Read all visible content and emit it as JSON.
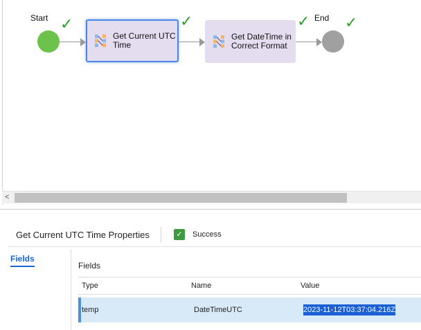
{
  "canvas": {
    "start_label": "Start",
    "end_label": "End",
    "check_mark": "✓",
    "tasks": [
      {
        "line1": "Get Current UTC",
        "line2": "Time"
      },
      {
        "line1": "Get DateTime in",
        "line2": "Correct Format"
      }
    ],
    "scroll_left_arrow": "<"
  },
  "panel": {
    "title": "Get Current UTC Time Properties",
    "status_check": "✓",
    "status_text": "Success",
    "side_tab": "Fields",
    "section_title": "Fields",
    "columns": {
      "type": "Type",
      "name": "Name",
      "value": "Value"
    },
    "rows": [
      {
        "type": "temp",
        "name": "DateTimeUTC",
        "value": "2023-11-12T03:37:04.216Z"
      }
    ]
  },
  "colors": {
    "start": "#6cc24a",
    "end": "#a0a0a0",
    "task_fill": "#e4dcef",
    "selection_border": "#4a86e8",
    "success": "#3d9a3d",
    "accent": "#1a66d6"
  }
}
